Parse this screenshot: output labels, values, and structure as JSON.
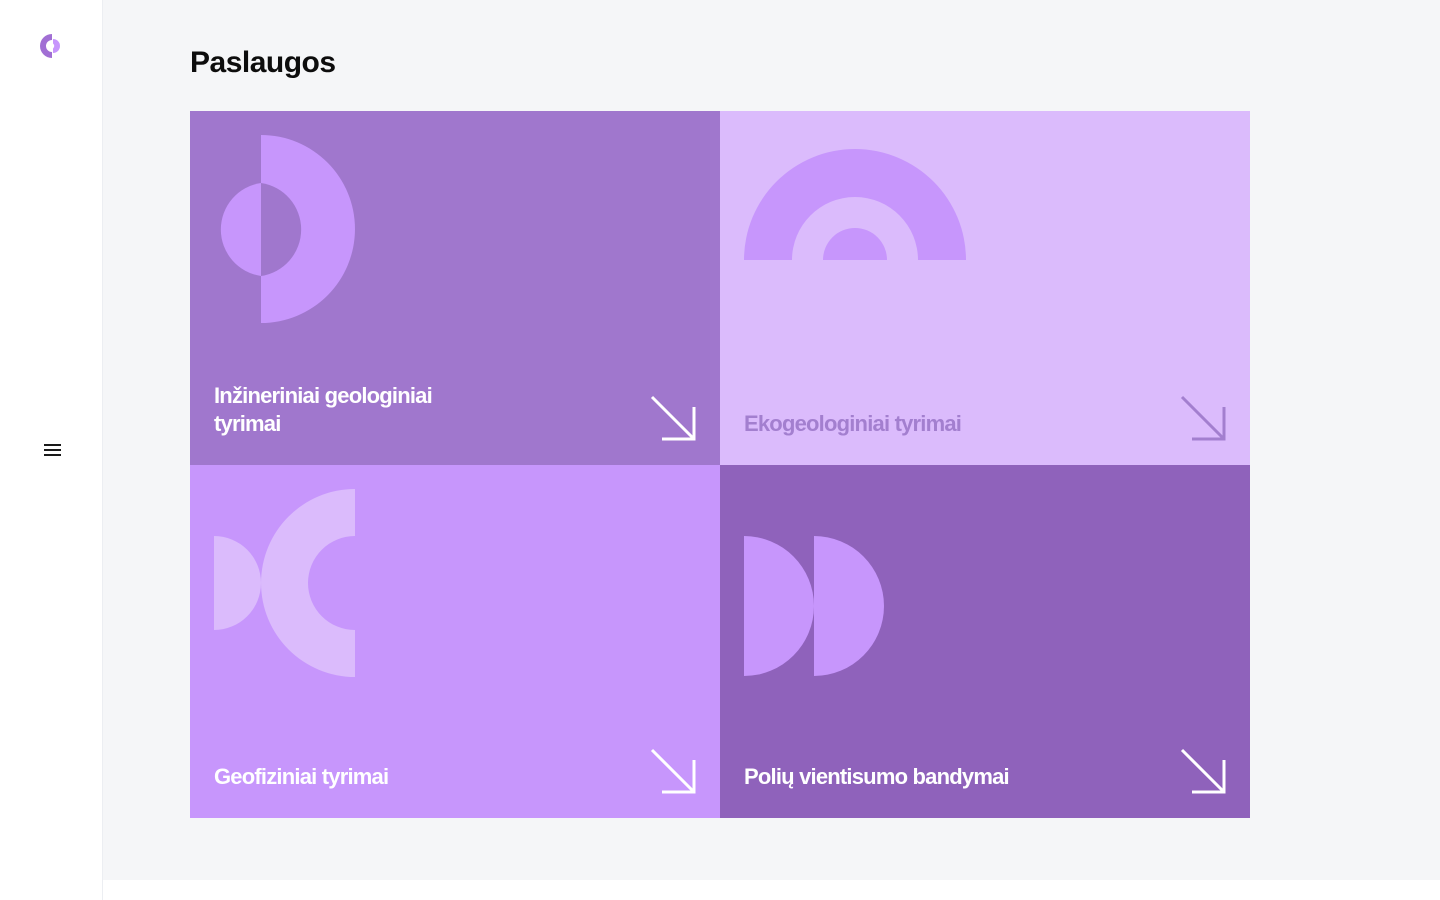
{
  "sidebar": {
    "logo": "brand-logo-icon",
    "menu_icon": "hamburger-menu-icon"
  },
  "page": {
    "title": "Paslaugos"
  },
  "services": [
    {
      "label": "Inžineriniai geologiniai tyrimai",
      "icon": "arrow-down-right-icon"
    },
    {
      "label": "Ekogeologiniai tyrimai",
      "icon": "arrow-down-right-icon"
    },
    {
      "label": "Geofiziniai tyrimai",
      "icon": "arrow-down-right-icon"
    },
    {
      "label": "Polių vientisumo bandymai",
      "icon": "arrow-down-right-icon"
    }
  ],
  "colors": {
    "card_1": "#a077cd",
    "card_2": "#dbbbfc",
    "card_3": "#c796fc",
    "card_4": "#8f62bb",
    "brand": "#a16fd4"
  }
}
